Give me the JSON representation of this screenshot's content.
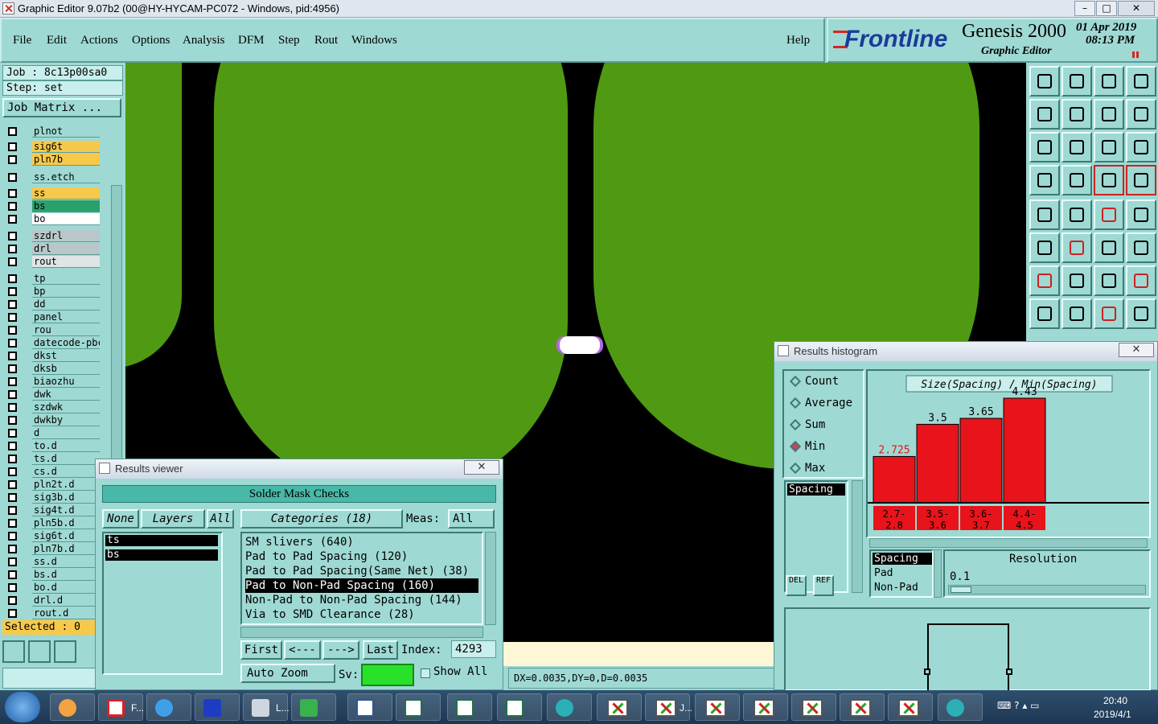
{
  "window": {
    "title": "Graphic Editor 9.07b2 (00@HY-HYCAM-PC072 - Windows, pid:4956)",
    "min": "–",
    "max": "□",
    "close": "✕"
  },
  "menu": {
    "items": [
      "File",
      "Edit",
      "Actions",
      "Options",
      "Analysis",
      "DFM",
      "Step",
      "Rout",
      "Windows"
    ],
    "help": "Help"
  },
  "brand": {
    "logo": "Frontline",
    "product": "Genesis 2000",
    "subtitle": "Graphic Editor",
    "date": "01 Apr 2019",
    "time": "08:13 PM"
  },
  "job": {
    "job_label": "Job : 8c13p00sa0",
    "step_label": "Step: set",
    "matrix_button": "Job Matrix ...",
    "selected": "Selected : 0"
  },
  "layers": [
    {
      "name": "plnot",
      "color": "#9fd9d3"
    },
    {
      "name": "sig6t",
      "color": "#f7c94a"
    },
    {
      "name": "pln7b",
      "color": "#f7c94a"
    },
    {
      "name": "ss.etch",
      "color": "#9fd9d3"
    },
    {
      "name": "ss",
      "color": "#f7c94a"
    },
    {
      "name": "bs",
      "color": "#2aa06a"
    },
    {
      "name": "bo",
      "color": "#ffffff"
    },
    {
      "name": "szdrl",
      "color": "#b9c7cb"
    },
    {
      "name": "drl",
      "color": "#b9c7cb"
    },
    {
      "name": "rout",
      "color": "#dfe5e7"
    },
    {
      "name": "tp",
      "color": "#9fd9d3"
    },
    {
      "name": "bp",
      "color": "#9fd9d3"
    },
    {
      "name": "dd",
      "color": "#9fd9d3"
    },
    {
      "name": "panel",
      "color": "#9fd9d3"
    },
    {
      "name": "rou",
      "color": "#9fd9d3"
    },
    {
      "name": "datecode-pbc",
      "color": "#9fd9d3"
    },
    {
      "name": "dkst",
      "color": "#9fd9d3"
    },
    {
      "name": "dksb",
      "color": "#9fd9d3"
    },
    {
      "name": "biaozhu",
      "color": "#9fd9d3"
    },
    {
      "name": "dwk",
      "color": "#9fd9d3"
    },
    {
      "name": "szdwk",
      "color": "#9fd9d3"
    },
    {
      "name": "dwkby",
      "color": "#9fd9d3"
    },
    {
      "name": "d",
      "color": "#9fd9d3"
    },
    {
      "name": "to.d",
      "color": "#9fd9d3"
    },
    {
      "name": "ts.d",
      "color": "#9fd9d3"
    },
    {
      "name": "cs.d",
      "color": "#9fd9d3"
    },
    {
      "name": "pln2t.d",
      "color": "#9fd9d3"
    },
    {
      "name": "sig3b.d",
      "color": "#9fd9d3"
    },
    {
      "name": "sig4t.d",
      "color": "#9fd9d3"
    },
    {
      "name": "pln5b.d",
      "color": "#9fd9d3"
    },
    {
      "name": "sig6t.d",
      "color": "#9fd9d3"
    },
    {
      "name": "pln7b.d",
      "color": "#9fd9d3"
    },
    {
      "name": "ss.d",
      "color": "#9fd9d3"
    },
    {
      "name": "bs.d",
      "color": "#9fd9d3"
    },
    {
      "name": "bo.d",
      "color": "#9fd9d3"
    },
    {
      "name": "drl.d",
      "color": "#9fd9d3"
    },
    {
      "name": "rout.d",
      "color": "#9fd9d3"
    }
  ],
  "results_viewer": {
    "title": "Results viewer",
    "header": "Solder Mask Checks",
    "none_btn": "None",
    "layers_btn": "Layers",
    "all_btn": "All",
    "layer_items": [
      "ts",
      "bs"
    ],
    "categories_btn": "Categories (18)",
    "meas_label": "Meas:",
    "meas_value": "All",
    "categories": [
      "SM slivers (640)",
      "Pad to Pad Spacing (120)",
      "Pad to Pad Spacing(Same Net) (38)",
      "Pad to Non-Pad Spacing (160)",
      "Non-Pad to Non-Pad Spacing (144)",
      "Via to SMD Clearance (28)"
    ],
    "selected_category": 3,
    "first": "First",
    "prev": "<---",
    "next": "--->",
    "last": "Last",
    "index_label": "Index:",
    "index_value": "4293",
    "zoom": "Auto Zoom",
    "sv_label": "Sv:",
    "show_all": "Show All"
  },
  "status": {
    "coords": "DX=0.0035,DY=0,D=0.0035"
  },
  "histogram": {
    "title": "Results histogram",
    "modes": [
      "Count",
      "Average",
      "Sum",
      "Min",
      "Max"
    ],
    "selected_mode": "Min",
    "list_items": [
      "Spacing"
    ],
    "chart_title": "Size(Spacing) / Min(Spacing)",
    "del": "DEL",
    "ref": "REF",
    "types": [
      "Spacing",
      "Pad",
      "Non-Pad"
    ],
    "resolution_label": "Resolution",
    "resolution_value": "0.1",
    "chart_data": {
      "type": "bar",
      "title": "Size(Spacing) / Min(Spacing)",
      "categories": [
        "2.7-2.8",
        "3.5-3.6",
        "3.6-3.7",
        "4.4-4.5"
      ],
      "values": [
        2.725,
        3.5,
        3.65,
        4.43
      ],
      "value_labels": [
        "2.725",
        "3.5",
        "3.65",
        "4.43"
      ],
      "bar_color": "#e8131b",
      "highlight_label_color": "#e8131b"
    }
  },
  "taskbar": {
    "clock_time": "20:40",
    "clock_date": "2019/4/1",
    "items": [
      "F...",
      "L...",
      "J..."
    ]
  },
  "colors": {
    "panel": "#9fd9d3",
    "copper": "#4f9a12",
    "canvas": "#000000"
  }
}
